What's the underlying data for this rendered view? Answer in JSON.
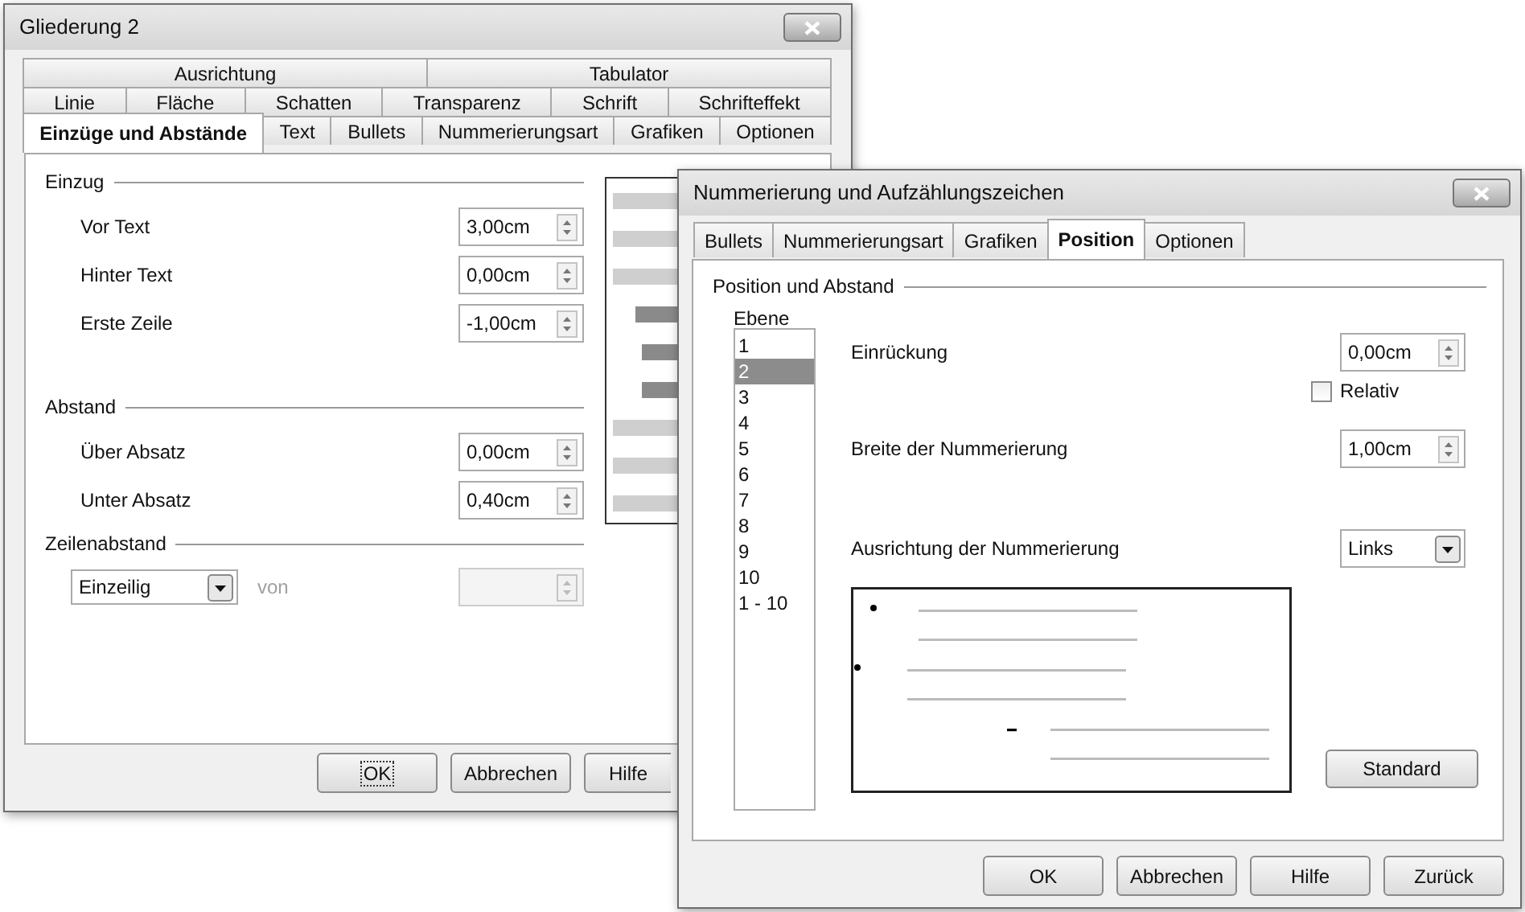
{
  "back_dialog": {
    "title": "Gliederung 2",
    "tab_rows": [
      [
        {
          "label": "Ausrichtung",
          "selected": false
        },
        {
          "label": "Tabulator",
          "selected": false
        }
      ],
      [
        {
          "label": "Linie",
          "selected": false
        },
        {
          "label": "Fläche",
          "selected": false
        },
        {
          "label": "Schatten",
          "selected": false
        },
        {
          "label": "Transparenz",
          "selected": false
        },
        {
          "label": "Schrift",
          "selected": false
        },
        {
          "label": "Schrifteffekt",
          "selected": false
        }
      ],
      [
        {
          "label": "Einzüge und Abstände",
          "selected": true
        },
        {
          "label": "Text",
          "selected": false
        },
        {
          "label": "Bullets",
          "selected": false
        },
        {
          "label": "Nummerierungsart",
          "selected": false
        },
        {
          "label": "Grafiken",
          "selected": false
        },
        {
          "label": "Optionen",
          "selected": false
        }
      ]
    ],
    "sections": [
      {
        "title": "Einzug",
        "fields": [
          {
            "label": "Vor Text",
            "value": "3,00cm"
          },
          {
            "label": "Hinter Text",
            "value": "0,00cm"
          },
          {
            "label": "Erste Zeile",
            "value": "-1,00cm"
          }
        ]
      },
      {
        "title": "Abstand",
        "fields": [
          {
            "label": "Über Absatz",
            "value": "0,00cm"
          },
          {
            "label": "Unter Absatz",
            "value": "0,40cm"
          }
        ]
      }
    ],
    "line_spacing": {
      "title": "Zeilenabstand",
      "select": "Einzeilig",
      "of_label": "von",
      "of_disabled": true
    },
    "buttons": [
      {
        "label": "OK",
        "focused": true
      },
      {
        "label": "Abbrechen",
        "focused": false
      },
      {
        "label": "Hilfe",
        "focused": false
      }
    ]
  },
  "front_dialog": {
    "title": "Nummerierung und Aufzählungszeichen",
    "tabs": [
      {
        "label": "Bullets",
        "selected": false
      },
      {
        "label": "Nummerierungsart",
        "selected": false
      },
      {
        "label": "Grafiken",
        "selected": false
      },
      {
        "label": "Position",
        "selected": true
      },
      {
        "label": "Optionen",
        "selected": false
      }
    ],
    "section_title": "Position und Abstand",
    "level_label": "Ebene",
    "levels": [
      {
        "label": "1",
        "selected": false
      },
      {
        "label": "2",
        "selected": true
      },
      {
        "label": "3",
        "selected": false
      },
      {
        "label": "4",
        "selected": false
      },
      {
        "label": "5",
        "selected": false
      },
      {
        "label": "6",
        "selected": false
      },
      {
        "label": "7",
        "selected": false
      },
      {
        "label": "8",
        "selected": false
      },
      {
        "label": "9",
        "selected": false
      },
      {
        "label": "10",
        "selected": false
      },
      {
        "label": "1 - 10",
        "selected": false
      }
    ],
    "indent": {
      "label": "Einrückung",
      "value": "0,00cm"
    },
    "relative": {
      "label": "Relativ",
      "checked": false
    },
    "width": {
      "label": "Breite der Nummerierung",
      "value": "1,00cm"
    },
    "alignment": {
      "label": "Ausrichtung der Nummerierung",
      "value": "Links"
    },
    "standard_button": "Standard",
    "buttons": [
      {
        "label": "OK"
      },
      {
        "label": "Abbrechen"
      },
      {
        "label": "Hilfe"
      },
      {
        "label": "Zurück"
      }
    ]
  }
}
